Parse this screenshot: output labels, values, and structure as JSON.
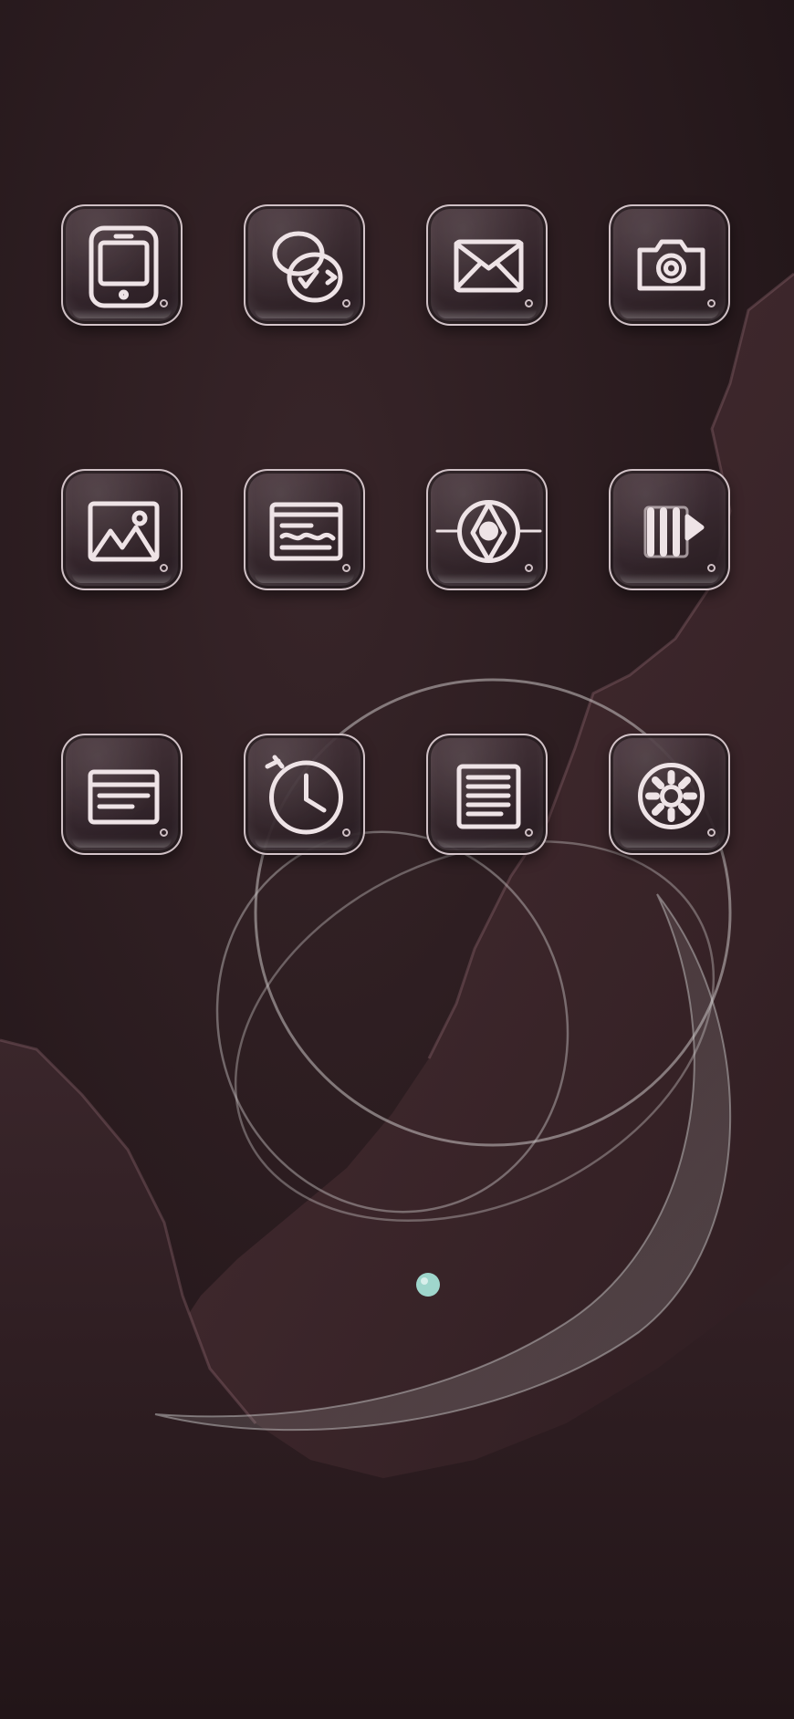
{
  "screen": {
    "type": "home-screen",
    "icon_style": "glass-outline"
  },
  "colors": {
    "background_dark": "#2a1c20",
    "paper_mauve": "#4a3036",
    "glyph": "#eee3e6",
    "icon_border": "#ebdce1",
    "bead": "#9fd6cc"
  },
  "apps": [
    {
      "icon": "phone-icon"
    },
    {
      "icon": "browser-icon"
    },
    {
      "icon": "mail-icon"
    },
    {
      "icon": "camera-icon"
    },
    {
      "icon": "photos-icon"
    },
    {
      "icon": "wallet-icon"
    },
    {
      "icon": "compass-icon"
    },
    {
      "icon": "music-icon"
    },
    {
      "icon": "calendar-icon"
    },
    {
      "icon": "clock-icon"
    },
    {
      "icon": "notes-icon"
    },
    {
      "icon": "settings-icon"
    }
  ]
}
